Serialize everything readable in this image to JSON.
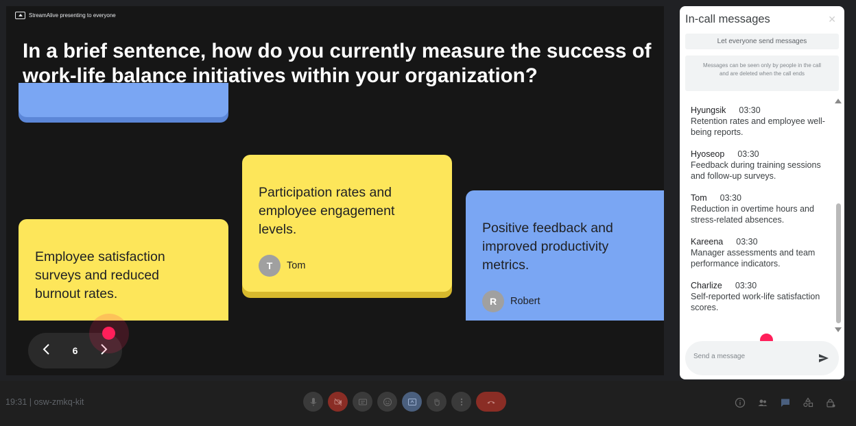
{
  "stage": {
    "presenting_label": "StreamAlive presenting to everyone",
    "question": "In a brief sentence, how do you currently measure the success of work-life balance initiatives within your organization?",
    "cards": [
      {
        "text": "Employee satisfaction surveys and reduced burnout rates.",
        "color": "#fde65a"
      },
      {
        "text": "Participation rates and employee engagement levels.",
        "author": "Tom",
        "initial": "T",
        "color": "#fde65a"
      },
      {
        "text": "Positive feedback and improved productivity metrics.",
        "author": "Robert",
        "initial": "R",
        "color": "#7aa6f3"
      }
    ],
    "page_number": "6",
    "prev_icon": "chevron-left-icon",
    "next_icon": "chevron-right-icon"
  },
  "panel": {
    "title": "In-call messages",
    "close_icon": "close-icon",
    "toggle_label": "Let everyone send messages",
    "info": "Messages can be seen only by people in the call and are deleted when the call ends",
    "messages": [
      {
        "name": "Hyungsik",
        "time": "03:30",
        "text": "Retention rates and employee well-being reports."
      },
      {
        "name": "Hyoseop",
        "time": "03:30",
        "text": "Feedback during training sessions and follow-up surveys."
      },
      {
        "name": "Tom",
        "time": "03:30",
        "text": "Reduction in overtime hours and stress-related absences."
      },
      {
        "name": "Kareena",
        "time": "03:30",
        "text": "Manager assessments and team performance indicators."
      },
      {
        "name": "Charlize",
        "time": "03:30",
        "text": "Self-reported work-life satisfaction scores."
      }
    ],
    "compose_placeholder": "Send a message",
    "send_icon": "send-icon"
  },
  "bottom_bar": {
    "meeting_info": "19:31 | osw-zmkq-kit",
    "controls": [
      "mic-icon",
      "camera-off-icon",
      "captions-icon",
      "emoji-icon",
      "present-icon",
      "raise-hand-icon",
      "more-options-icon",
      "hang-up-icon"
    ],
    "right_controls": [
      "info-icon",
      "people-icon",
      "chat-icon",
      "activities-icon",
      "host-controls-icon"
    ]
  },
  "colors": {
    "accent_pink": "#ff1f5a",
    "card_yellow": "#fde65a",
    "card_blue": "#7aa6f3",
    "stage_bg": "#161616"
  }
}
